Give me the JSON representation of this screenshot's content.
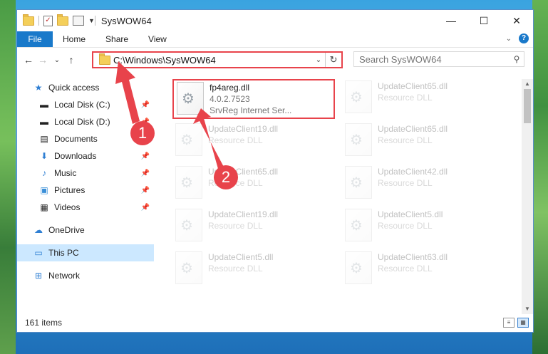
{
  "window": {
    "title": "SysWOW64",
    "controls": {
      "minimize": "—",
      "maximize": "☐",
      "close": "✕"
    }
  },
  "ribbon": {
    "tabs": [
      "File",
      "Home",
      "Share",
      "View"
    ],
    "help": "?"
  },
  "nav": {
    "back": "←",
    "forward": "→",
    "recent": "⌄",
    "up": "↑",
    "address": "C:\\Windows\\SysWOW64",
    "search_placeholder": "Search SysWOW64"
  },
  "sidebar": {
    "items": [
      {
        "label": "Quick access",
        "icon": "star-icon"
      },
      {
        "label": "Local Disk (C:)",
        "icon": "drive-icon",
        "pinned": true
      },
      {
        "label": "Local Disk (D:)",
        "icon": "drive-icon",
        "pinned": true
      },
      {
        "label": "Documents",
        "icon": "documents-icon",
        "pinned": true
      },
      {
        "label": "Downloads",
        "icon": "downloads-icon",
        "pinned": true
      },
      {
        "label": "Music",
        "icon": "music-icon",
        "pinned": true
      },
      {
        "label": "Pictures",
        "icon": "pictures-icon",
        "pinned": true
      },
      {
        "label": "Videos",
        "icon": "videos-icon",
        "pinned": true
      },
      {
        "label": "OneDrive",
        "icon": "cloud-icon"
      },
      {
        "label": "This PC",
        "icon": "computer-icon",
        "selected": true
      },
      {
        "label": "Network",
        "icon": "network-icon"
      }
    ]
  },
  "files": [
    {
      "name": "fp4areg.dll",
      "line2": "4.0.2.7523",
      "line3": "SrvReg Internet Ser...",
      "highlighted": true
    },
    {
      "name": "UpdateClient65.dll",
      "line2": "Resource DLL"
    },
    {
      "name": "UpdateClient19.dll",
      "line2": "Resource DLL"
    },
    {
      "name": "UpdateClient65.dll",
      "line2": "Resource DLL"
    },
    {
      "name": "UpdateClient65.dll",
      "line2": "Resource DLL"
    },
    {
      "name": "UpdateClient42.dll",
      "line2": "Resource DLL"
    },
    {
      "name": "UpdateClient19.dll",
      "line2": "Resource DLL"
    },
    {
      "name": "UpdateClient5.dll",
      "line2": "Resource DLL"
    },
    {
      "name": "UpdateClient5.dll",
      "line2": "Resource DLL"
    },
    {
      "name": "UpdateClient63.dll",
      "line2": "Resource DLL"
    }
  ],
  "status": {
    "items": "161 items"
  },
  "annotations": {
    "step1": "1",
    "step2": "2"
  },
  "colors": {
    "accent": "#1979ca",
    "highlight": "#e8434b",
    "selected": "#cce8ff"
  }
}
